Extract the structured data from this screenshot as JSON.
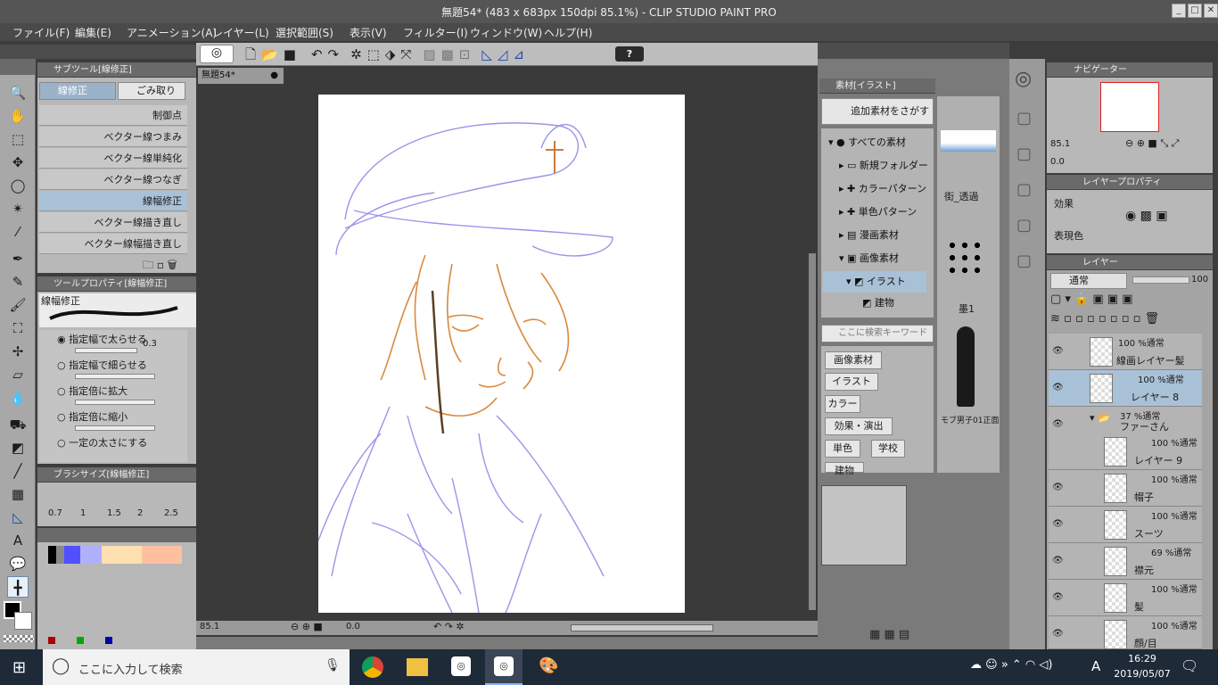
{
  "window": {
    "title": "無題54* (483 x 683px 150dpi 85.1%)  - CLIP STUDIO PAINT PRO",
    "min": "_",
    "max": "□",
    "close": "✕"
  },
  "menu": [
    "ファイル(F)",
    "編集(E)",
    "アニメーション(A)",
    "レイヤー(L)",
    "選択範囲(S)",
    "表示(V)",
    "フィルター(I)",
    "ウィンドウ(W)",
    "ヘルプ(H)"
  ],
  "subtool": {
    "title": "サブツール[線修正]",
    "tabs": [
      "線修正",
      "ごみ取り"
    ],
    "items": [
      "制御点",
      "ベクター線つまみ",
      "ベクター線単純化",
      "ベクター線つなぎ",
      "線幅修正",
      "ベクター線描き直し",
      "ベクター線幅描き直し"
    ]
  },
  "toolprop": {
    "title": "ツールプロパティ[線幅修正]",
    "name": "線幅修正",
    "options": [
      "指定幅で太らせる",
      "指定幅で細らせる",
      "指定倍に拡大",
      "指定倍に縮小",
      "一定の太さにする"
    ],
    "value": "0.3"
  },
  "brushsize": {
    "title": "ブラシサイズ[線幅修正]",
    "sizes": [
      "0.7",
      "1",
      "1.5",
      "2",
      "2.5"
    ]
  },
  "canvas": {
    "tab": "無題54*",
    "zoom": "85.1",
    "rotation": "0.0"
  },
  "material": {
    "title": "素材[イラスト]",
    "search_button": "追加素材をさがす",
    "tree": [
      "すべての素材",
      "新規フォルダー",
      "カラーパターン",
      "単色パターン",
      "漫画素材",
      "画像素材",
      "イラスト",
      "建物"
    ],
    "search_placeholder": "ここに検索キーワードを入力",
    "tags": [
      "画像素材",
      "イラスト",
      "カラー",
      "効果・演出",
      "単色",
      "学校",
      "建物"
    ],
    "thumbs": [
      "街_透過",
      "墨1",
      "モブ男子01正面"
    ]
  },
  "navigator": {
    "title": "ナビゲーター",
    "zoom": "85.1",
    "rotation": "0.0"
  },
  "layerprop": {
    "title": "レイヤープロパティ",
    "effect": "効果",
    "expression": "表現色"
  },
  "layers": {
    "title": "レイヤー",
    "blend": "通常",
    "opacity": "100",
    "items": [
      {
        "pct": "100 %通常",
        "name": "線画レイヤー髪"
      },
      {
        "pct": "100 %通常",
        "name": "レイヤー 8"
      },
      {
        "pct": "37 %通常",
        "name": "ファーさん"
      },
      {
        "pct": "100 %通常",
        "name": "レイヤー 9"
      },
      {
        "pct": "100 %通常",
        "name": "帽子"
      },
      {
        "pct": "100 %通常",
        "name": "スーツ"
      },
      {
        "pct": "69 %通常",
        "name": "襟元"
      },
      {
        "pct": "100 %通常",
        "name": "髪"
      },
      {
        "pct": "100 %通常",
        "name": "顔/目"
      }
    ]
  },
  "taskbar": {
    "search_placeholder": "ここに入力して検索",
    "time": "16:29",
    "date": "2019/05/07",
    "ime": "A"
  }
}
